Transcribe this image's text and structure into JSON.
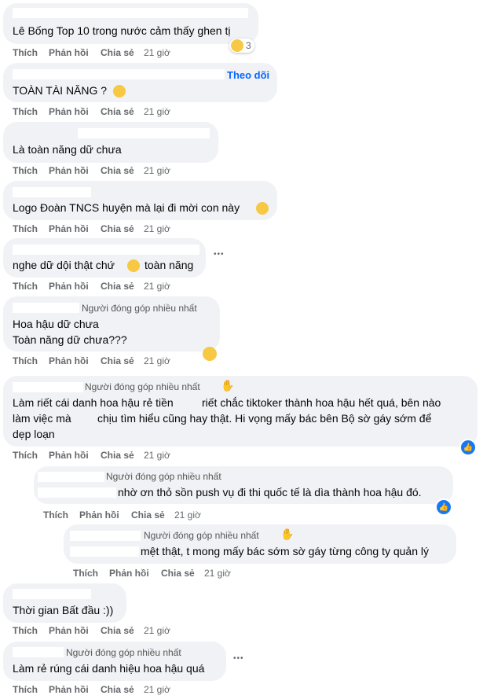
{
  "actions": {
    "like": "Thích",
    "reply": "Phản hồi",
    "share": "Chia sẻ",
    "time": "21 giờ"
  },
  "follow": "Theo dõi",
  "badge": "Người đóng góp nhiều nhất",
  "react_count": "3",
  "more": "•••",
  "comments": [
    {
      "text": "Lê Bống Top 10 trong nước cảm thấy ghen tị"
    },
    {
      "text": "TOÀN TÀI NĂNG ?"
    },
    {
      "text": "Là toàn năng dữ chưa"
    },
    {
      "text": "Logo Đoàn TNCS huyện mà lại đi mời con này"
    },
    {
      "text_a": "nghe dữ dội thật chứ",
      "text_b": "toàn năng"
    },
    {
      "line1": "Hoa hậu dữ chưa",
      "line2": "Toàn năng dữ chưa???"
    },
    {
      "l1a": "Làm riết cái danh hoa hậu rẻ tiền",
      "l1b": "riết chắc tiktoker thành hoa hậu hết quá, bên nào",
      "l2a": "làm việc mà",
      "l2b": "chịu tìm hiểu cũng hay thật. Hi vọng mấy bác bên Bộ sờ gáy sớm để",
      "l3": "dẹp loạn"
    },
    {
      "text": "nhờ ơn thỏ sồn push vụ đi thi quốc tế là dìa thành hoa hậu đó."
    },
    {
      "text": "mệt thật, t mong mấy bác sớm sờ gáy từng công ty quản lý"
    },
    {
      "text": "Thời gian Bất đầu :))"
    },
    {
      "text": "Làm rẻ rúng cái danh hiệu hoa hậu quá"
    }
  ],
  "colors": {
    "bubble": "#f0f2f5",
    "link": "#0866ff",
    "meta": "#65676b"
  }
}
